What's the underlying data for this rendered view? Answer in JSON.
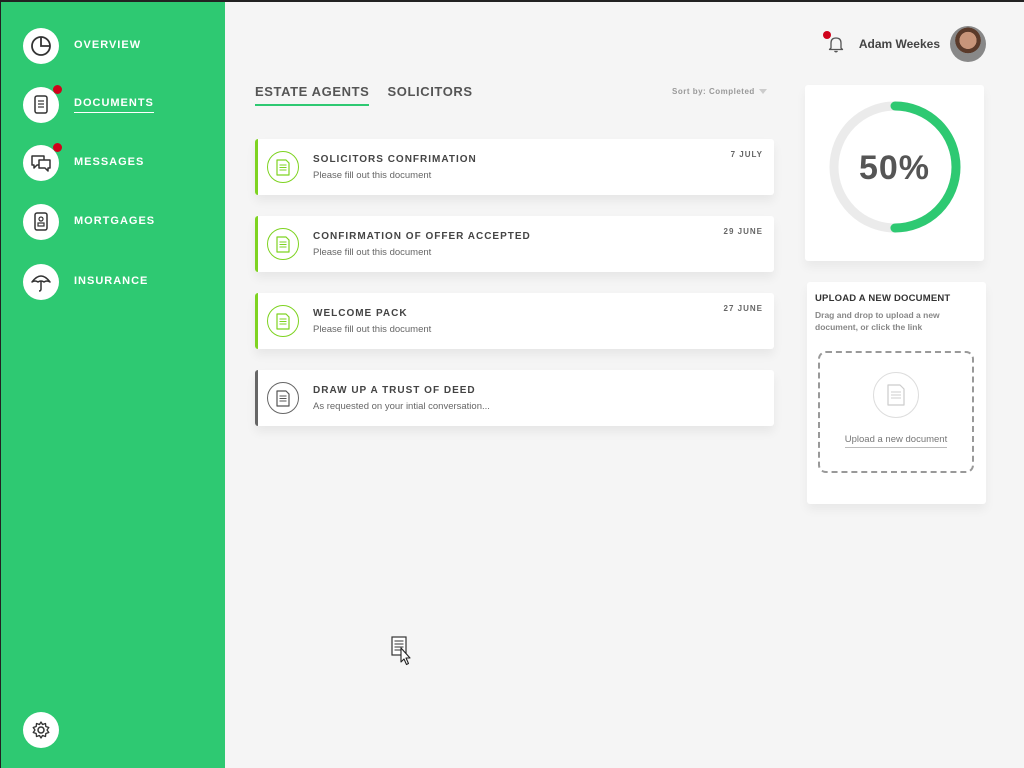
{
  "sidebar": {
    "items": [
      {
        "label": "OVERVIEW",
        "icon": "pie-chart-icon",
        "notification": false,
        "active": false
      },
      {
        "label": "DOCUMENTS",
        "icon": "document-icon",
        "notification": true,
        "active": true
      },
      {
        "label": "MESSAGES",
        "icon": "chat-icon",
        "notification": true,
        "active": false
      },
      {
        "label": "MORTGAGES",
        "icon": "id-card-icon",
        "notification": false,
        "active": false
      },
      {
        "label": "INSURANCE",
        "icon": "umbrella-icon",
        "notification": false,
        "active": false
      }
    ],
    "settings_icon": "gear-icon"
  },
  "header": {
    "user_name": "Adam Weekes",
    "bell_icon": "bell-icon",
    "bell_notification": true
  },
  "tabs": [
    {
      "label": "ESTATE AGENTS",
      "active": true
    },
    {
      "label": "SOLICITORS",
      "active": false
    }
  ],
  "sort": {
    "label": "Sort by: Completed"
  },
  "documents": [
    {
      "title": "SOLICITORS CONFRIMATION",
      "subtitle": "Please fill out this document",
      "date": "7 JULY",
      "status": "pending"
    },
    {
      "title": "CONFIRMATION OF OFFER ACCEPTED",
      "subtitle": "Please fill out this document",
      "date": "29 JUNE",
      "status": "pending"
    },
    {
      "title": "WELCOME PACK",
      "subtitle": "Please fill out this document",
      "date": "27 JUNE",
      "status": "pending"
    },
    {
      "title": "DRAW UP A TRUST OF DEED",
      "subtitle": "As requested on your intial conversation...",
      "date": "",
      "status": "other"
    }
  ],
  "progress": {
    "text": "50%",
    "value": 0.5
  },
  "upload": {
    "title": "UPLOAD A NEW DOCUMENT",
    "description": "Drag and drop to upload a new document, or click the link",
    "link_label": "Upload a new document"
  },
  "colors": {
    "brand_green": "#2ec972",
    "accent_lime": "#7ed321",
    "notification_red": "#d0021b",
    "progress_track": "#ebebeb"
  }
}
